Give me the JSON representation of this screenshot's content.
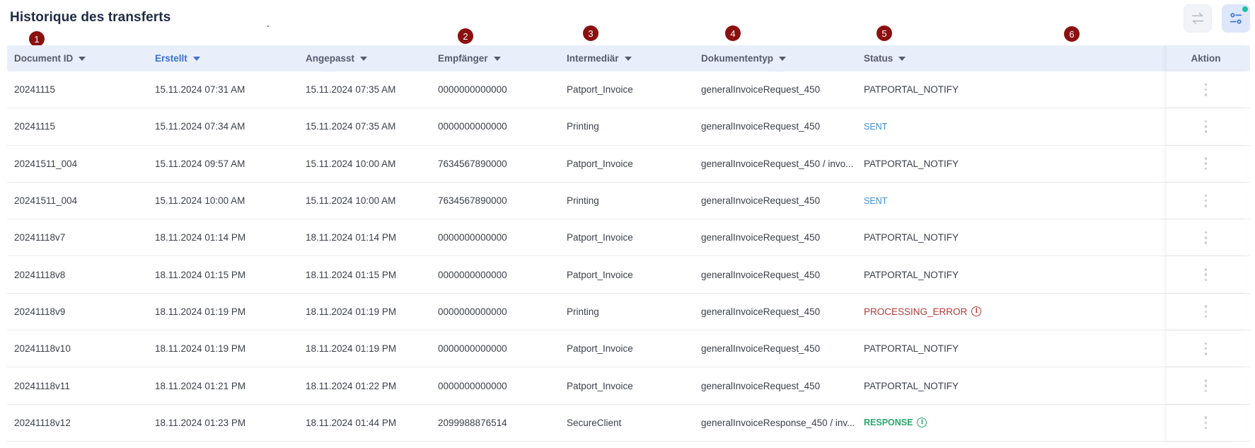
{
  "page": {
    "title": "Historique des transferts"
  },
  "toolbar": {
    "transfer_icon": "transfer-arrows-icon",
    "filter_icon": "filter-settings-icon",
    "filter_indicator_color": "#17c3a3"
  },
  "markers": [
    "1",
    "2",
    "3",
    "4",
    "5",
    "6"
  ],
  "columns": {
    "document_id": "Document ID",
    "created": "Erstellt",
    "modified": "Angepasst",
    "recipient": "Empfänger",
    "intermediary": "Intermediär",
    "doctype": "Dokumententyp",
    "status": "Status",
    "action": "Aktion"
  },
  "rows": [
    {
      "id": "20241115",
      "created": "15.11.2024 07:31 AM",
      "modified": "15.11.2024 07:35 AM",
      "recipient": "0000000000000",
      "intermediary": "Patport_Invoice",
      "doctype": "generalInvoiceRequest_450",
      "status": "PATPORTAL_NOTIFY",
      "status_kind": "normal"
    },
    {
      "id": "20241115",
      "created": "15.11.2024 07:34 AM",
      "modified": "15.11.2024 07:35 AM",
      "recipient": "0000000000000",
      "intermediary": "Printing",
      "doctype": "generalInvoiceRequest_450",
      "status": "SENT",
      "status_kind": "sent"
    },
    {
      "id": "20241511_004",
      "created": "15.11.2024 09:57 AM",
      "modified": "15.11.2024 10:00 AM",
      "recipient": "7634567890000",
      "intermediary": "Patport_Invoice",
      "doctype": "generalInvoiceRequest_450 / invo...",
      "status": "PATPORTAL_NOTIFY",
      "status_kind": "normal"
    },
    {
      "id": "20241511_004",
      "created": "15.11.2024 10:00 AM",
      "modified": "15.11.2024 10:00 AM",
      "recipient": "7634567890000",
      "intermediary": "Printing",
      "doctype": "generalInvoiceRequest_450",
      "status": "SENT",
      "status_kind": "sent"
    },
    {
      "id": "20241118v7",
      "created": "18.11.2024 01:14 PM",
      "modified": "18.11.2024 01:14 PM",
      "recipient": "0000000000000",
      "intermediary": "Patport_Invoice",
      "doctype": "generalInvoiceRequest_450",
      "status": "PATPORTAL_NOTIFY",
      "status_kind": "normal"
    },
    {
      "id": "20241118v8",
      "created": "18.11.2024 01:15 PM",
      "modified": "18.11.2024 01:15 PM",
      "recipient": "0000000000000",
      "intermediary": "Patport_Invoice",
      "doctype": "generalInvoiceRequest_450",
      "status": "PATPORTAL_NOTIFY",
      "status_kind": "normal"
    },
    {
      "id": "20241118v9",
      "created": "18.11.2024 01:19 PM",
      "modified": "18.11.2024 01:19 PM",
      "recipient": "0000000000000",
      "intermediary": "Printing",
      "doctype": "generalInvoiceRequest_450",
      "status": "PROCESSING_ERROR",
      "status_kind": "error"
    },
    {
      "id": "20241118v10",
      "created": "18.11.2024 01:19 PM",
      "modified": "18.11.2024 01:19 PM",
      "recipient": "0000000000000",
      "intermediary": "Patport_Invoice",
      "doctype": "generalInvoiceRequest_450",
      "status": "PATPORTAL_NOTIFY",
      "status_kind": "normal"
    },
    {
      "id": "20241118v11",
      "created": "18.11.2024 01:21 PM",
      "modified": "18.11.2024 01:22 PM",
      "recipient": "0000000000000",
      "intermediary": "Patport_Invoice",
      "doctype": "generalInvoiceRequest_450",
      "status": "PATPORTAL_NOTIFY",
      "status_kind": "normal"
    },
    {
      "id": "20241118v12",
      "created": "18.11.2024 01:23 PM",
      "modified": "18.11.2024 01:44 PM",
      "recipient": "2099988876514",
      "intermediary": "SecureClient",
      "doctype": "generalInvoiceResponse_450 / inv...",
      "status": "RESPONSE",
      "status_kind": "response"
    }
  ],
  "colors": {
    "accent": "#3d6fd8",
    "sent": "#3d8fd8",
    "error": "#b33a3a",
    "response": "#27a86b",
    "marker": "#8b1010"
  }
}
